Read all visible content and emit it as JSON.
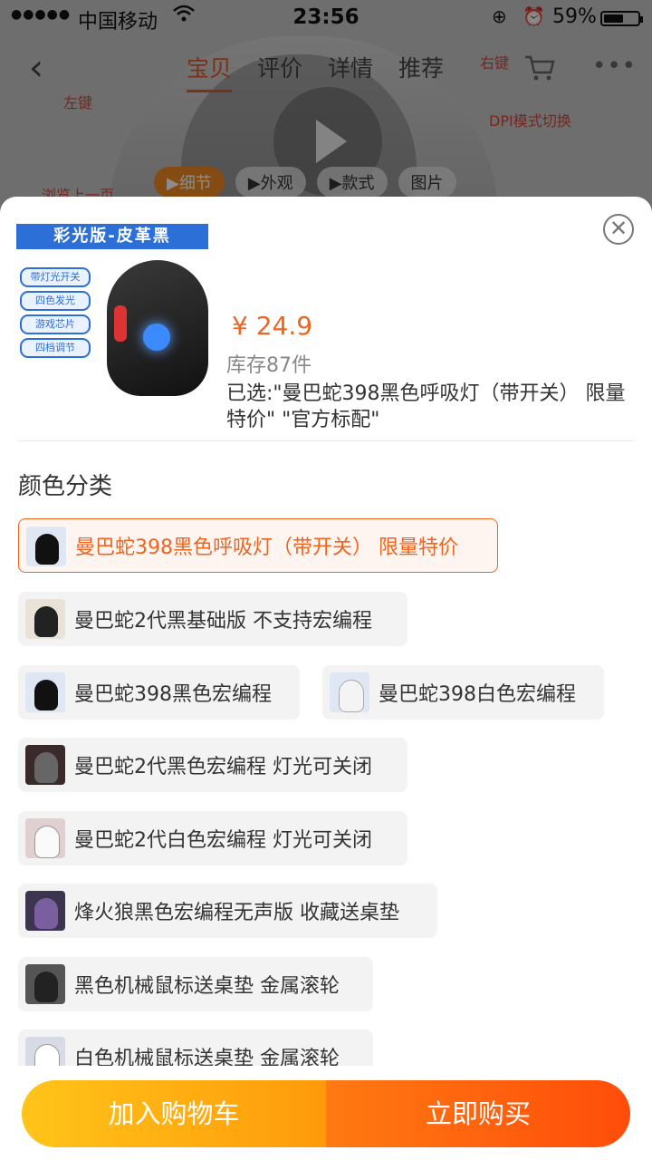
{
  "status_bar": {
    "signal_dots": "●●●●●",
    "carrier": "中国移动",
    "time": "23:56",
    "battery_percent": "59%",
    "battery_level": 0.59
  },
  "nav": {
    "back_icon": "chevron-left-icon",
    "tabs": [
      "宝贝",
      "评价",
      "详情",
      "推荐"
    ],
    "active_tab": "宝贝",
    "cart_icon": "cart-icon",
    "more_icon": "more-icon",
    "more_glyph": "•••"
  },
  "background": {
    "labels": [
      "右键",
      "左键",
      "DPI模式切换",
      "浏览上一页"
    ],
    "media_tabs": [
      "▶细节",
      "▶外观",
      "▶款式",
      "图片"
    ]
  },
  "product": {
    "image_banner": "彩光版-皮革黑",
    "image_chips": [
      "带灯光开关",
      "四色发光",
      "游戏芯片",
      "四档调节"
    ],
    "price": "¥ 24.9",
    "stock": "库存87件",
    "selected": "已选:\"曼巴蛇398黑色呼吸灯（带开关） 限量特价\" \"官方标配\""
  },
  "close_glyph": "✕",
  "section_title": "颜色分类",
  "options": [
    {
      "label": "曼巴蛇398黑色呼吸灯（带开关） 限量特价",
      "selected": true
    },
    {
      "label": "曼巴蛇2代黑基础版 不支持宏编程"
    },
    {
      "label": "曼巴蛇398黑色宏编程"
    },
    {
      "label": "曼巴蛇398白色宏编程"
    },
    {
      "label": "曼巴蛇2代黑色宏编程 灯光可关闭"
    },
    {
      "label": "曼巴蛇2代白色宏编程 灯光可关闭"
    },
    {
      "label": "烽火狼黑色宏编程无声版 收藏送桌垫"
    },
    {
      "label": "黑色机械鼠标送桌垫 金属滚轮"
    },
    {
      "label": "白色机械鼠标送桌垫 金属滚轮"
    }
  ],
  "buttons": {
    "add_to_cart": "加入购物车",
    "buy_now": "立即购买"
  },
  "colors": {
    "accent": "#f0641e",
    "cart_button": "#ffb314",
    "buy_button": "#ff5a0e"
  }
}
